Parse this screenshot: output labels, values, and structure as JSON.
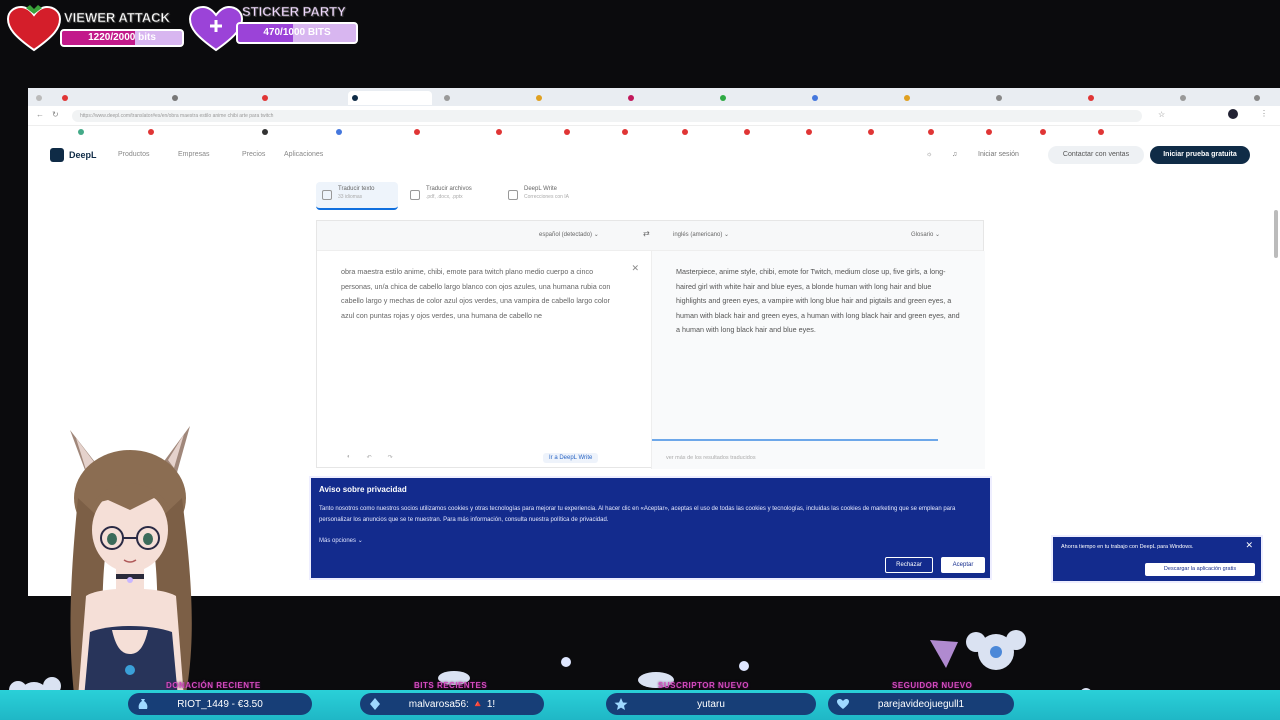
{
  "overlay": {
    "viewer_attack": {
      "title": "VIEWER ATTACK",
      "progress": "1220/2000 bits",
      "fraction": 0.61,
      "color": "#c21a8a"
    },
    "sticker_party": {
      "title": "STICKER PARTY",
      "progress": "470/1000 BITS",
      "fraction": 0.47,
      "color": "#9b43d8"
    }
  },
  "browser": {
    "tabs": [
      "",
      "",
      "",
      "",
      "",
      "",
      "",
      "",
      "",
      "",
      "",
      "",
      "",
      "",
      ""
    ],
    "url": "https://www.deepl.com/translator#es/en/obra maestra estilo anime chibi arte para twitch"
  },
  "deepl": {
    "logo": "DeepL",
    "nav": [
      "Productos",
      "Empresas",
      "Precios",
      "Aplicaciones"
    ],
    "login": "Iniciar sesión",
    "contact": "Contactar con ventas",
    "trial": "Iniciar prueba gratuita",
    "modes": [
      {
        "label": "Traducir texto",
        "sub": "33 idiomas"
      },
      {
        "label": "Traducir archivos",
        "sub": ".pdf, .docx, .pptx"
      },
      {
        "label": "DeepL Write",
        "sub": "Correcciones con IA"
      }
    ],
    "source_lang": "español (detectado)",
    "target_lang": "inglés (americano)",
    "glossary": "Glosario",
    "source_text": "obra maestra estilo anime, chibi, emote para twitch plano medio cuerpo a cinco personas, un/a chica de cabello largo blanco con ojos azules, una humana rubia con cabello largo y mechas de color azul ojos verdes, una vampira de cabello largo color azul con puntas rojas y ojos verdes, una humana de cabello ne",
    "target_text": "Masterpiece, anime style, chibi, emote for Twitch, medium close up, five girls, a long-haired girl with white hair and blue eyes, a blonde human with long hair and blue highlights and green eyes, a vampire with long blue hair and pigtails and green eyes, a human with black hair and green eyes, a human with long black hair and green eyes, and a human with long black hair and blue eyes.",
    "write_button": "Ir a DeepL Write",
    "target_footer": "ver más de los resultados traducidos"
  },
  "privacy": {
    "title": "Aviso sobre privacidad",
    "body": "Tanto nosotros como nuestros socios utilizamos cookies y otras tecnologías para mejorar tu experiencia. Al hacer clic en «Aceptar», aceptas el uso de todas las cookies y tecnologías, incluidas las cookies de marketing que se emplean para personalizar los anuncios que se te muestran. Para más información, consulta nuestra política de privacidad.",
    "more": "Más opciones",
    "reject": "Rechazar",
    "accept": "Aceptar"
  },
  "toast": {
    "message": "Ahorra tiempo en tu trabajo con DeepL para Windows.",
    "button": "Descargar la aplicación gratis"
  },
  "stream_bar": [
    {
      "label": "DONACIÓN RECIENTE",
      "value": "RIOT_1449 - €3.50",
      "icon": "money-bag-icon"
    },
    {
      "label": "BITS RECIENTES",
      "value": "malvarosa56:  🔺  1!",
      "icon": "bits-gem-icon"
    },
    {
      "label": "SUSCRIPTOR NUEVO",
      "value": "yutaru",
      "icon": "star-icon"
    },
    {
      "label": "SEGUIDOR NUEVO",
      "value": "parejavideojuegull1",
      "icon": "heart-icon"
    }
  ]
}
